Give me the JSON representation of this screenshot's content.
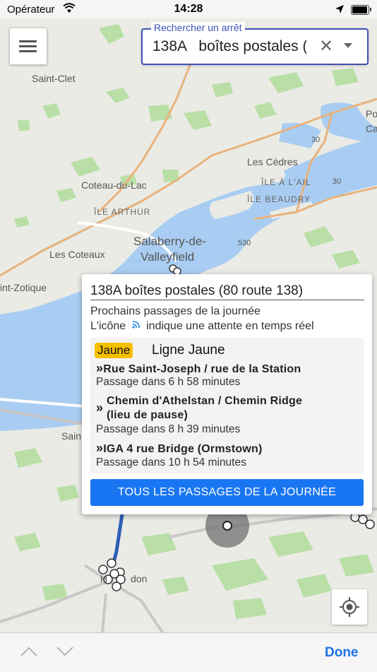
{
  "status_bar": {
    "carrier": "Opérateur",
    "time": "14:28"
  },
  "map": {
    "labels": {
      "saint_clet": "Saint-Clet",
      "pointe_partial": "Po",
      "cedar_partial": "Ca",
      "les_cedres": "Les Cèdres",
      "ile_a_lail": "ÎLE À L'AIL",
      "ile_beaudry": "ÎLE BEAUDRY",
      "coteau_du_lac": "Coteau-du-Lac",
      "ile_arthur": "ÎLE ARTHUR",
      "salaberry": "Salaberry-de-",
      "valleyfield": "Valleyfield",
      "les_coteaux": "Les Coteaux",
      "saint_zotique": "int-Zotique",
      "sain_partial": "Sain",
      "huntingdon_h": "H",
      "huntingdon_tail": "don"
    },
    "route_shields": [
      "30",
      "30",
      "530"
    ]
  },
  "search": {
    "label": "Rechercher un arrêt",
    "value": "138A   boîtes postales ("
  },
  "popup": {
    "title": "138A boîtes postales (80 route 138)",
    "subtitle_1": "Prochains passages de la journée",
    "subtitle_2_before": "L'icône",
    "subtitle_2_after": "indique une attente en temps réel",
    "line": {
      "badge": "Jaune",
      "badge_color": "#f5c000",
      "name": "Ligne Jaune",
      "departures": [
        {
          "stop": "Rue Saint-Joseph / rue de la Station",
          "eta": "Passage dans 6 h 58 minutes"
        },
        {
          "stop_line1": "Chemin d'Athelstan / Chemin Ridge",
          "stop_line2": "(lieu de pause)",
          "eta": "Passage dans 8 h 39 minutes"
        },
        {
          "stop": "IGA 4 rue Bridge (Ormstown)",
          "eta": "Passage dans 10 h 54 minutes"
        }
      ]
    },
    "button": "TOUS LES PASSAGES DE LA JOURNÉE"
  },
  "bottom_bar": {
    "done": "Done"
  },
  "colors": {
    "accent": "#3f51b5",
    "primary_button": "#1976f2",
    "water": "#a9cdf2",
    "done": "#1b72e8"
  },
  "icons": {
    "menu": "hamburger-icon",
    "clear": "clear-icon",
    "dropdown": "caret-down-icon",
    "realtime": "realtime-signal-icon",
    "locate": "crosshair-icon",
    "prev": "chevron-up-icon",
    "next": "chevron-down-icon"
  }
}
